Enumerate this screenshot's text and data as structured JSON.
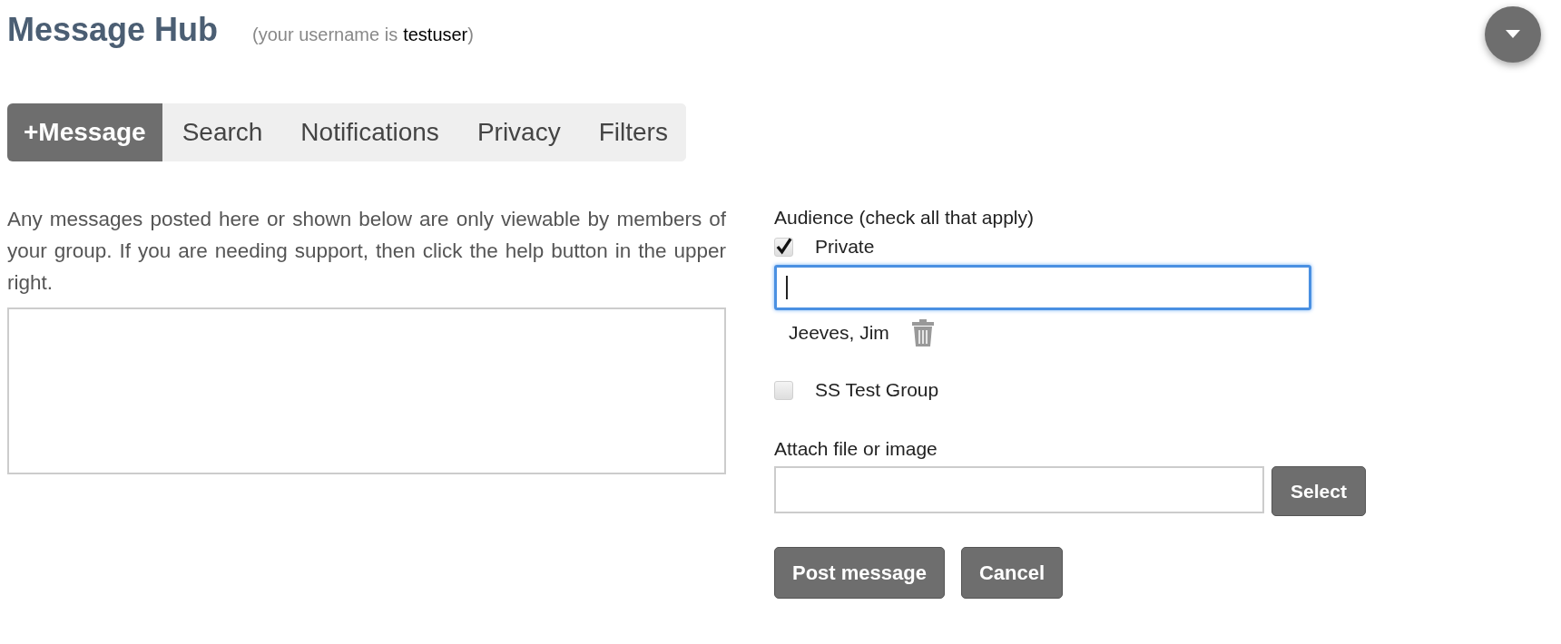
{
  "header": {
    "title": "Message Hub",
    "username_prefix": "(your username is",
    "username": "testuser",
    "username_suffix": ")"
  },
  "tabs": [
    {
      "label": "+Message",
      "selected": true
    },
    {
      "label": "Search",
      "selected": false
    },
    {
      "label": "Notifications",
      "selected": false
    },
    {
      "label": "Privacy",
      "selected": false
    },
    {
      "label": "Filters",
      "selected": false
    }
  ],
  "intro": "Any messages posted here or shown below are only viewable by members of your group. If you are needing support, then click the help button in the upper right.",
  "audience": {
    "label": "Audience (check all that apply)",
    "options": [
      {
        "label": "Private",
        "checked": true,
        "recipients": [
          "Jeeves, Jim"
        ]
      },
      {
        "label": "SS Test Group",
        "checked": false
      }
    ]
  },
  "attach": {
    "label": "Attach file or image",
    "button": "Select"
  },
  "buttons": [
    "Post message",
    "Cancel"
  ]
}
